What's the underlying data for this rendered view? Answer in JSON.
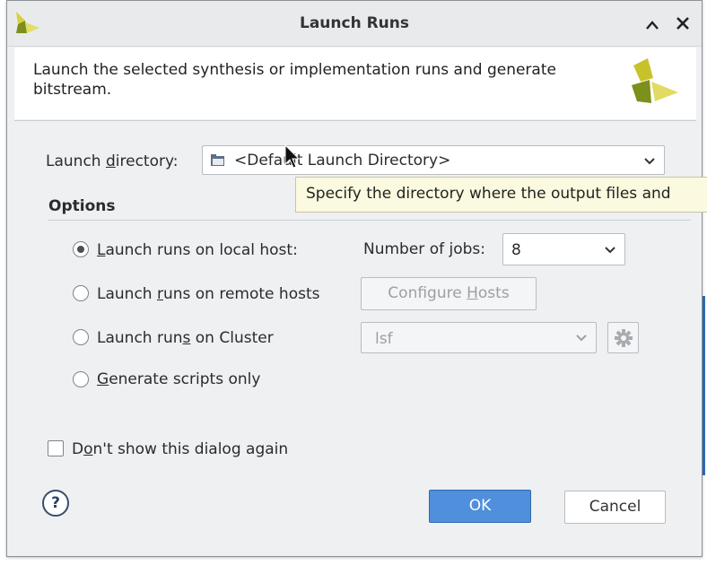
{
  "window": {
    "title": "Launch Runs"
  },
  "header": {
    "description": "Launch the selected synthesis or implementation runs and generate bitstream."
  },
  "launch_directory": {
    "label": "Launch directory:",
    "value": "<Default Launch Directory>",
    "tooltip": "Specify the directory where the output files and"
  },
  "options": {
    "title": "Options",
    "local": {
      "label": "Launch runs on local host:",
      "selected": true
    },
    "jobs": {
      "label": "Number of jobs:",
      "value": "8"
    },
    "remote": {
      "label": "Launch runs on remote hosts",
      "selected": false
    },
    "configure_hosts": "Configure Hosts",
    "cluster": {
      "label": "Launch runs on Cluster",
      "selected": false,
      "value": "lsf"
    },
    "scripts": {
      "label": "Generate scripts only",
      "selected": false
    }
  },
  "dont_show": {
    "label": "Don't show this dialog again",
    "checked": false
  },
  "buttons": {
    "ok": "OK",
    "cancel": "Cancel",
    "help": "?"
  },
  "icons": [
    "vivado-logo-icon",
    "collapse-icon",
    "close-icon",
    "folder-icon",
    "chevron-down-icon",
    "gear-icon",
    "help-icon",
    "mouse-cursor-icon"
  ],
  "colors": {
    "accent": "#4f8fdc",
    "tooltip_bg": "#fbf9df",
    "logo_green": "#8ca21f"
  }
}
